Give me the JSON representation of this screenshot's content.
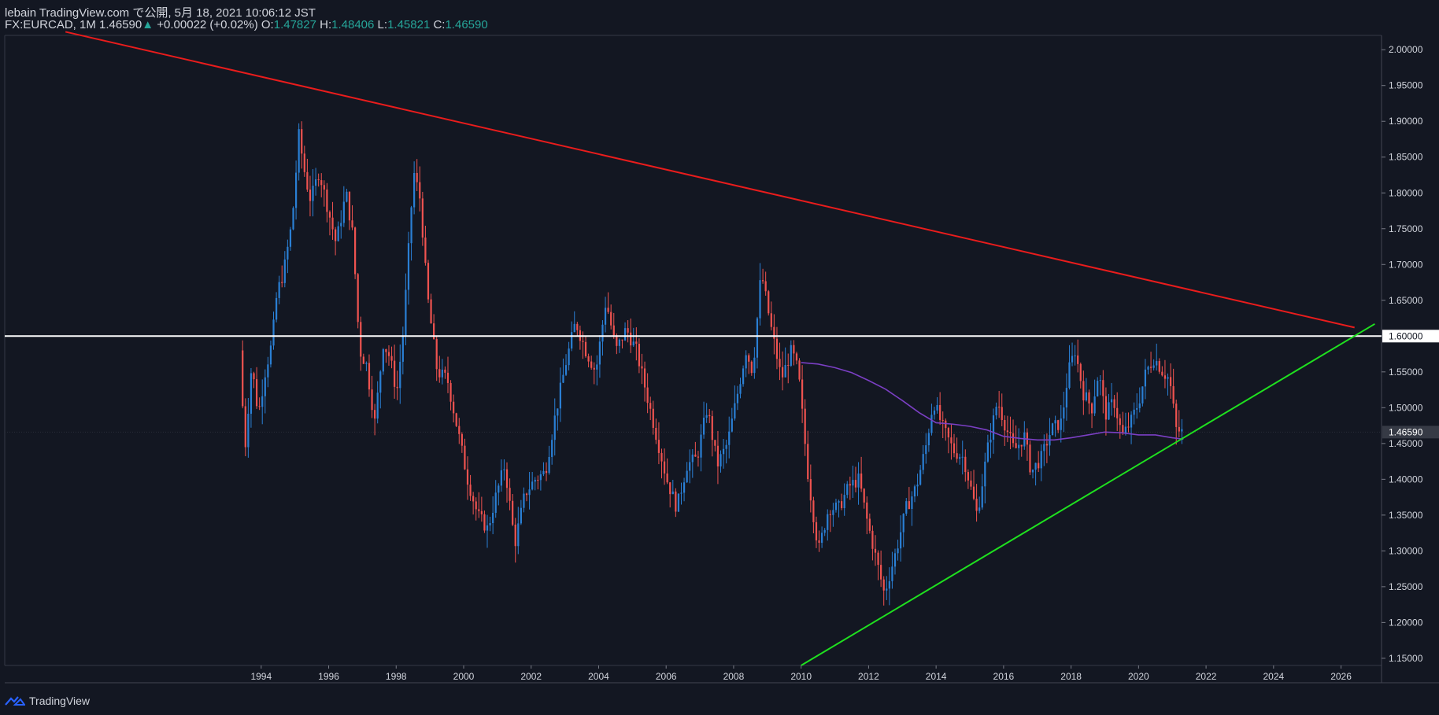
{
  "header": {
    "line1": "lebain TradingView.com で公開, 5月 18, 2021 10:06:12 JST",
    "symbol_tf": "FX:EURCAD, 1M 1.46590",
    "change_arrow": "▲",
    "change": "+0.00022 (+0.02%)",
    "open_label": "O:",
    "open": "1.47827",
    "high_label": "H:",
    "high": "1.48406",
    "low_label": "L:",
    "low": "1.45821",
    "close_label": "C:",
    "close": "1.46590"
  },
  "price_scale": {
    "ticks": [
      "2.00000",
      "1.95000",
      "1.90000",
      "1.85000",
      "1.80000",
      "1.75000",
      "1.70000",
      "1.65000",
      "1.60000",
      "1.55000",
      "1.50000",
      "1.45000",
      "1.40000",
      "1.35000",
      "1.30000",
      "1.25000",
      "1.20000",
      "1.15000"
    ],
    "highlight_level": "1.60000",
    "last_price": "1.46590"
  },
  "time_scale": {
    "ticks": [
      "1994",
      "1996",
      "1998",
      "2000",
      "2002",
      "2004",
      "2006",
      "2008",
      "2010",
      "2012",
      "2014",
      "2016",
      "2018",
      "2020",
      "2022",
      "2024",
      "2026"
    ]
  },
  "colors": {
    "background": "#131722",
    "up": "#2a7fd4",
    "down": "#ef5350",
    "resistance": "#e91c1c",
    "support": "#1fe01f",
    "horizontal": "#ffffff",
    "ma": "#7b3fc4"
  },
  "footer": {
    "brand": "TradingView",
    "icon": "tradingview-logo-icon"
  },
  "chart_data": {
    "type": "candlestick",
    "symbol": "FX:EURCAD",
    "timeframe": "1M",
    "x_range": [
      1986.4,
      2027.2
    ],
    "ylim": [
      1.14,
      2.02
    ],
    "annotations": [
      {
        "type": "trendline",
        "color": "resistance",
        "points": [
          [
            1988.2,
            2.025
          ],
          [
            2026.4,
            1.612
          ]
        ]
      },
      {
        "type": "trendline",
        "color": "support",
        "points": [
          [
            2010.0,
            1.14
          ],
          [
            2027.0,
            1.617
          ]
        ]
      },
      {
        "type": "horizontal",
        "color": "horizontal",
        "value": 1.6
      }
    ],
    "ma_series": [
      [
        2010.0,
        1.563
      ],
      [
        2010.5,
        1.561
      ],
      [
        2011.0,
        1.556
      ],
      [
        2011.5,
        1.549
      ],
      [
        2012.0,
        1.538
      ],
      [
        2012.5,
        1.526
      ],
      [
        2013.0,
        1.51
      ],
      [
        2013.5,
        1.493
      ],
      [
        2014.0,
        1.479
      ],
      [
        2014.5,
        1.477
      ],
      [
        2015.0,
        1.474
      ],
      [
        2015.5,
        1.469
      ],
      [
        2016.0,
        1.46
      ],
      [
        2016.5,
        1.457
      ],
      [
        2017.0,
        1.455
      ],
      [
        2017.5,
        1.455
      ],
      [
        2018.0,
        1.458
      ],
      [
        2018.5,
        1.462
      ],
      [
        2019.0,
        1.466
      ],
      [
        2019.5,
        1.465
      ],
      [
        2020.0,
        1.462
      ],
      [
        2020.5,
        1.462
      ],
      [
        2021.0,
        1.458
      ],
      [
        2021.33,
        1.456
      ]
    ],
    "price_path": [
      [
        1993.45,
        1.58
      ],
      [
        1993.6,
        1.44
      ],
      [
        1993.8,
        1.56
      ],
      [
        1994.0,
        1.49
      ],
      [
        1994.2,
        1.55
      ],
      [
        1994.4,
        1.59
      ],
      [
        1994.55,
        1.66
      ],
      [
        1994.75,
        1.69
      ],
      [
        1995.0,
        1.76
      ],
      [
        1995.2,
        1.88
      ],
      [
        1995.4,
        1.82
      ],
      [
        1995.55,
        1.79
      ],
      [
        1995.8,
        1.83
      ],
      [
        1996.0,
        1.79
      ],
      [
        1996.3,
        1.73
      ],
      [
        1996.6,
        1.8
      ],
      [
        1996.8,
        1.74
      ],
      [
        1997.0,
        1.58
      ],
      [
        1997.2,
        1.56
      ],
      [
        1997.45,
        1.48
      ],
      [
        1997.7,
        1.59
      ],
      [
        1997.9,
        1.57
      ],
      [
        1998.1,
        1.52
      ],
      [
        1998.3,
        1.61
      ],
      [
        1998.6,
        1.83
      ],
      [
        1998.8,
        1.79
      ],
      [
        1999.0,
        1.66
      ],
      [
        1999.3,
        1.55
      ],
      [
        1999.6,
        1.54
      ],
      [
        1999.9,
        1.47
      ],
      [
        2000.2,
        1.4
      ],
      [
        2000.5,
        1.35
      ],
      [
        2000.8,
        1.33
      ],
      [
        2001.0,
        1.37
      ],
      [
        2001.3,
        1.42
      ],
      [
        2001.6,
        1.31
      ],
      [
        2001.9,
        1.38
      ],
      [
        2002.2,
        1.4
      ],
      [
        2002.5,
        1.41
      ],
      [
        2002.8,
        1.49
      ],
      [
        2003.1,
        1.56
      ],
      [
        2003.4,
        1.62
      ],
      [
        2003.7,
        1.58
      ],
      [
        2004.0,
        1.55
      ],
      [
        2004.3,
        1.65
      ],
      [
        2004.6,
        1.58
      ],
      [
        2004.9,
        1.61
      ],
      [
        2005.2,
        1.58
      ],
      [
        2005.5,
        1.52
      ],
      [
        2005.8,
        1.46
      ],
      [
        2006.1,
        1.4
      ],
      [
        2006.4,
        1.36
      ],
      [
        2006.7,
        1.42
      ],
      [
        2007.0,
        1.43
      ],
      [
        2007.3,
        1.5
      ],
      [
        2007.6,
        1.42
      ],
      [
        2007.9,
        1.45
      ],
      [
        2008.2,
        1.52
      ],
      [
        2008.45,
        1.58
      ],
      [
        2008.65,
        1.55
      ],
      [
        2008.9,
        1.69
      ],
      [
        2009.2,
        1.61
      ],
      [
        2009.5,
        1.54
      ],
      [
        2009.8,
        1.58
      ],
      [
        2010.0,
        1.55
      ],
      [
        2010.3,
        1.4
      ],
      [
        2010.6,
        1.3
      ],
      [
        2010.9,
        1.36
      ],
      [
        2011.2,
        1.36
      ],
      [
        2011.5,
        1.39
      ],
      [
        2011.8,
        1.4
      ],
      [
        2012.0,
        1.35
      ],
      [
        2012.3,
        1.29
      ],
      [
        2012.55,
        1.24
      ],
      [
        2012.9,
        1.3
      ],
      [
        2013.2,
        1.36
      ],
      [
        2013.5,
        1.39
      ],
      [
        2013.8,
        1.45
      ],
      [
        2014.0,
        1.51
      ],
      [
        2014.3,
        1.47
      ],
      [
        2014.6,
        1.44
      ],
      [
        2014.9,
        1.43
      ],
      [
        2015.1,
        1.39
      ],
      [
        2015.3,
        1.35
      ],
      [
        2015.6,
        1.44
      ],
      [
        2015.9,
        1.51
      ],
      [
        2016.1,
        1.48
      ],
      [
        2016.4,
        1.44
      ],
      [
        2016.7,
        1.46
      ],
      [
        2016.9,
        1.41
      ],
      [
        2017.2,
        1.43
      ],
      [
        2017.5,
        1.47
      ],
      [
        2017.8,
        1.48
      ],
      [
        2018.0,
        1.55
      ],
      [
        2018.2,
        1.58
      ],
      [
        2018.45,
        1.52
      ],
      [
        2018.7,
        1.5
      ],
      [
        2018.9,
        1.55
      ],
      [
        2019.1,
        1.49
      ],
      [
        2019.35,
        1.51
      ],
      [
        2019.6,
        1.46
      ],
      [
        2019.85,
        1.48
      ],
      [
        2020.1,
        1.51
      ],
      [
        2020.3,
        1.55
      ],
      [
        2020.55,
        1.57
      ],
      [
        2020.8,
        1.55
      ],
      [
        2021.0,
        1.54
      ],
      [
        2021.2,
        1.47
      ],
      [
        2021.33,
        1.466
      ]
    ]
  }
}
